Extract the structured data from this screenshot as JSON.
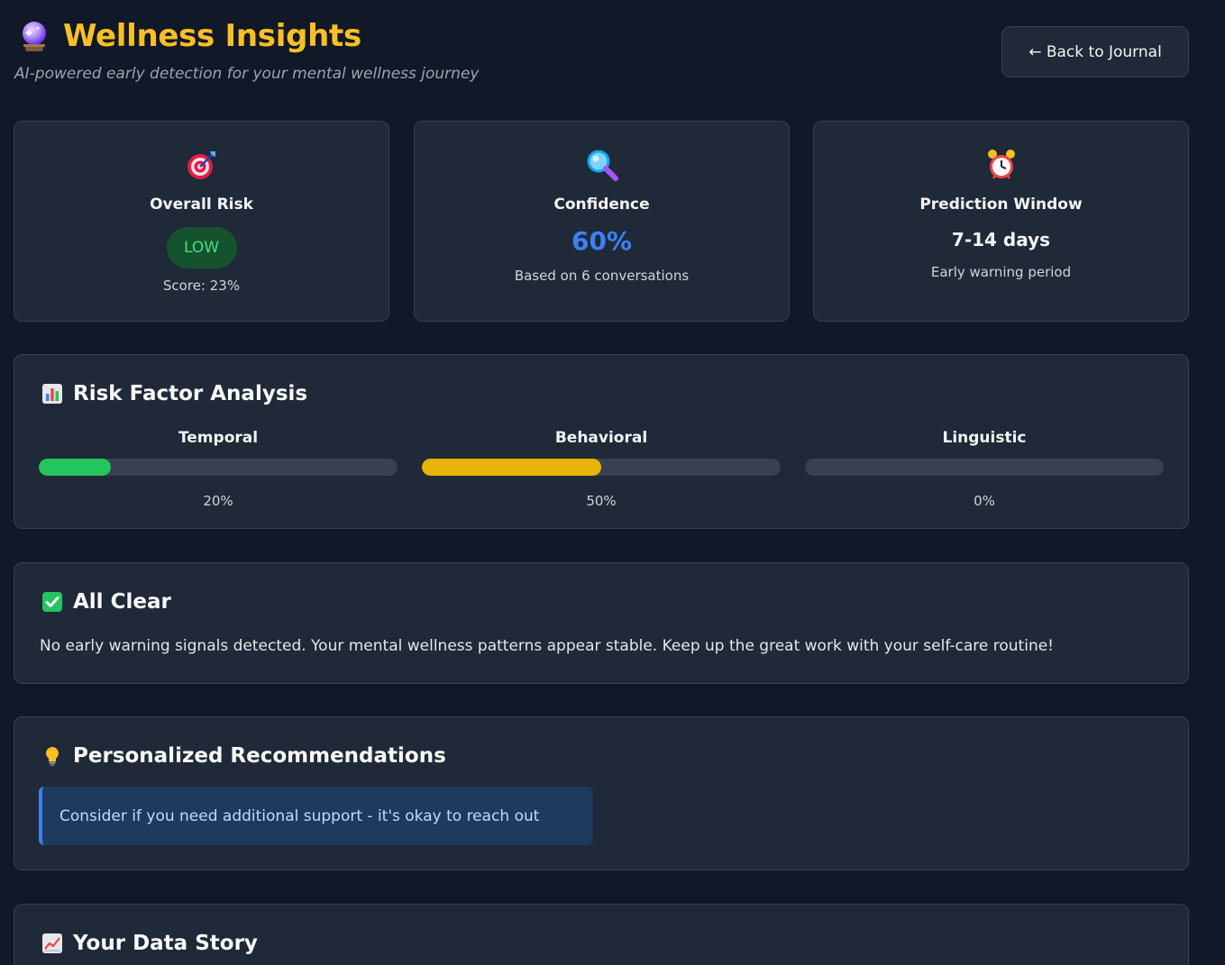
{
  "header": {
    "title": "Wellness Insights",
    "title_icon": "crystal-ball-icon",
    "subtitle": "AI-powered early detection for your mental wellness journey",
    "back_button": "← Back to Journal"
  },
  "stats": {
    "risk": {
      "icon": "target-icon",
      "label": "Overall Risk",
      "level": "LOW",
      "score": "Score: 23%"
    },
    "confidence": {
      "icon": "magnifier-icon",
      "label": "Confidence",
      "value": "60%",
      "sub": "Based on 6 conversations"
    },
    "window": {
      "icon": "alarm-clock-icon",
      "label": "Prediction Window",
      "value": "7-14 days",
      "sub": "Early warning period"
    }
  },
  "risk_factors": {
    "title": "Risk Factor Analysis",
    "icon": "bar-chart-icon",
    "items": [
      {
        "name": "Temporal",
        "percent_label": "20%",
        "value": 20,
        "color": "#22c55e"
      },
      {
        "name": "Behavioral",
        "percent_label": "50%",
        "value": 50,
        "color": "#eab308"
      },
      {
        "name": "Linguistic",
        "percent_label": "0%",
        "value": 0,
        "color": "#ef4444"
      }
    ]
  },
  "all_clear": {
    "title": "All Clear",
    "icon": "check-mark-icon",
    "text": "No early warning signals detected. Your mental wellness patterns appear stable. Keep up the great work with your self-care routine!"
  },
  "recommendations": {
    "title": "Personalized Recommendations",
    "icon": "light-bulb-icon",
    "items": [
      "Consider if you need additional support - it's okay to reach out"
    ]
  },
  "data_story": {
    "title": "Your Data Story",
    "icon": "chart-increasing-icon"
  },
  "colors": {
    "accent_gold": "#fbbf24",
    "accent_blue": "#3b82f6",
    "low_green": "#4ade80",
    "background": "#111827",
    "card": "#1f2937"
  }
}
